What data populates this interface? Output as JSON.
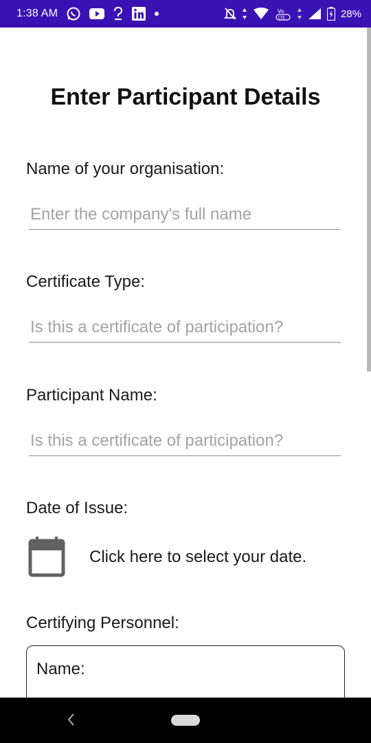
{
  "status_bar": {
    "time": "1:38 AM",
    "battery": "28%",
    "icons": [
      "whatsapp-icon",
      "youtube-icon",
      "question-icon",
      "linkedin-icon",
      "dot-icon",
      "mute-icon",
      "data-arrows-icon",
      "wifi-icon",
      "volte-icon",
      "signal-icon",
      "battery-icon"
    ]
  },
  "form": {
    "title": "Enter Participant Details",
    "organisation_label": "Name of your organisation:",
    "organisation_placeholder": "Enter the company's full name",
    "certificate_type_label": "Certificate Type:",
    "certificate_type_placeholder": "Is this a certificate of participation?",
    "participant_name_label": "Participant Name:",
    "participant_name_placeholder": "Is this a certificate of participation?",
    "date_label": "Date of Issue:",
    "date_prompt": "Click here to select your date.",
    "personnel_label": "Certifying Personnel:",
    "personnel_name_label": "Name:"
  },
  "colors": {
    "status_bar": "#3a12b4",
    "nav_bar": "#000000",
    "placeholder": "#a3a3a3"
  }
}
